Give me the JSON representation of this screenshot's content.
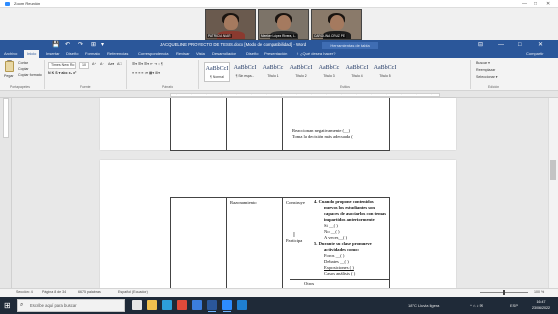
{
  "zoom": {
    "title": "Zoom Reunión",
    "participants": [
      {
        "name": "PATRICIA NIAR",
        "bg": "#6a5a4e",
        "shirt": "#8b3a2f"
      },
      {
        "name": "Meeker López Rivera, L.",
        "bg": "#7c7368",
        "shirt": "#2d2d2d"
      },
      {
        "name": "CAROLINA CRUZ PE",
        "bg": "#8a7a6a",
        "shirt": "#1d1d1d"
      }
    ],
    "controls": [
      "—",
      "□",
      "✕"
    ]
  },
  "word": {
    "title": "JACQUELINE PROYECTO DE TESIS.docx [Modo de compatibilidad] - Word",
    "tools_tab": "Herramientas de tabla",
    "window_controls": [
      "⊟",
      "—",
      "□",
      "✕"
    ],
    "quick_access": [
      "💾",
      "↶",
      "↷",
      "⊞",
      "▾"
    ],
    "tabs": [
      "Archivo",
      "Inicio",
      "Insertar",
      "Diseño",
      "Formato",
      "Referencias",
      "Correspondencia",
      "Revisar",
      "Vista",
      "Desarrollador",
      "Diseño",
      "Presentación",
      "♀ ¿Qué desea hacer?"
    ],
    "share": "Compartir",
    "ribbon": {
      "clipboard": {
        "paste": "Pegar",
        "cut": "Cortar",
        "copy": "Copiar",
        "format_painter": "Copiar formato",
        "label": "Portapapeles"
      },
      "font": {
        "name": "Times New Ro",
        "size": "10",
        "grow": "A⁺",
        "shrink": "A⁻",
        "case": "Aa▾",
        "clear": "A⃠",
        "label": "Fuente",
        "row2": "N  K  S ▾ abc  x₂  x²"
      },
      "paragraph": {
        "label": "Párrafo",
        "row1": "☰▾ ☰▾ ☰▾  ⇤ ⇥  ↕  ¶",
        "row2": "≡  ≡  ≡  ≡  ↕▾  ▦▾  ⊞▾"
      },
      "styles": {
        "label": "Estilos",
        "items": [
          {
            "sample": "AaBbCcI",
            "name": "¶ Normal"
          },
          {
            "sample": "AaBbCcI",
            "name": "¶ Sin espa..."
          },
          {
            "sample": "AaBbCc",
            "name": "Título 1"
          },
          {
            "sample": "AaBbCcI",
            "name": "Título 2"
          },
          {
            "sample": "AaBbCc",
            "name": "Título 3"
          },
          {
            "sample": "AaBbCcI",
            "name": "Título 4"
          },
          {
            "sample": "AaBbCcI",
            "name": "Título 5"
          }
        ]
      },
      "editing": {
        "find": "Buscar ▾",
        "replace": "Reemplazar",
        "select": "Seleccionar ▾",
        "label": "Edición"
      }
    },
    "document": {
      "page1": [
        "Reaccionan negativamente (__)",
        "Toma la decisión más adecuada ("
      ],
      "page2": {
        "col1": "Razonamiento",
        "col2a": "Construye",
        "col2b": "Participa",
        "item4_title_1": "4.  Cuando   propone   contenidos",
        "item4_title_2": "nuevos   los   estudiantes   son",
        "item4_title_3": "capaces de asociarlos con temas",
        "item4_title_4": "impartidos anteriormente",
        "item4_opts": [
          "Si    __( )",
          "No    __( )",
          "A veces__( )"
        ],
        "item5_title_1": "5.  Durante   su   clase   promueve",
        "item5_title_2": "actividades como:",
        "item5_opts": [
          "Foros     __( )",
          "Debates     __( )",
          "Exposiciones ( )",
          "Casos análisis ( )"
        ],
        "other": "Otros"
      }
    },
    "status": {
      "section": "Sección: 4",
      "page": "Página 8 de 34",
      "words": "6675 palabras",
      "lang": "Español (Ecuador)",
      "zoom": "100 %"
    }
  },
  "taskbar": {
    "search_placeholder": "Escribe aquí para buscar",
    "weather": "18°C  Lluvia ligera",
    "tray_icons": "^  ⌂  ♪  ✉",
    "lang": "ESP",
    "time": "16:47",
    "date": "23/06/2022",
    "apps": [
      {
        "name": "task-view",
        "color": "#e6e6e6"
      },
      {
        "name": "file-explorer",
        "color": "#f2c14e"
      },
      {
        "name": "edge",
        "color": "#2d9fd9"
      },
      {
        "name": "chrome",
        "color": "#e04a3a"
      },
      {
        "name": "store",
        "color": "#3b7ddd"
      },
      {
        "name": "word",
        "color": "#2b579a"
      },
      {
        "name": "zoom",
        "color": "#2d8cff"
      },
      {
        "name": "mail",
        "color": "#1f7fd0"
      }
    ]
  }
}
